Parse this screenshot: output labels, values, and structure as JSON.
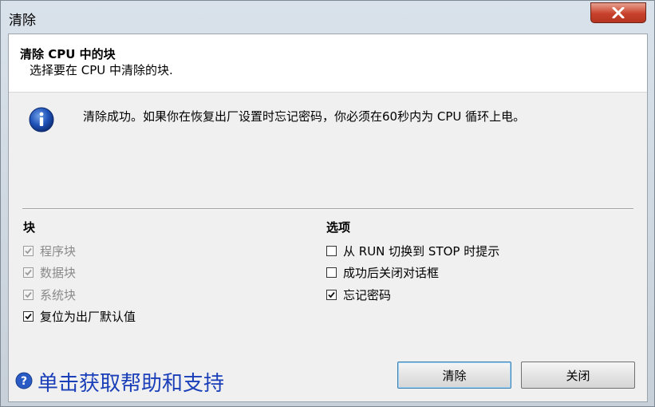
{
  "window": {
    "title": "清除"
  },
  "header": {
    "title": "清除 CPU 中的块",
    "subtitle": "选择要在 CPU 中清除的块."
  },
  "message": {
    "text": "清除成功。如果你在恢复出厂设置时忘记密码，你必须在60秒内为 CPU 循环上电。"
  },
  "blocks": {
    "title": "块",
    "items": [
      {
        "label": "程序块",
        "checked": true,
        "disabled": true
      },
      {
        "label": "数据块",
        "checked": true,
        "disabled": true
      },
      {
        "label": "系统块",
        "checked": true,
        "disabled": true
      },
      {
        "label": "复位为出厂默认值",
        "checked": true,
        "disabled": false
      }
    ]
  },
  "options": {
    "title": "选项",
    "items": [
      {
        "label": "从 RUN 切换到 STOP 时提示",
        "checked": false,
        "disabled": false
      },
      {
        "label": "成功后关闭对话框",
        "checked": false,
        "disabled": false
      },
      {
        "label": "忘记密码",
        "checked": true,
        "disabled": false
      }
    ]
  },
  "help": {
    "label": "单击获取帮助和支持"
  },
  "buttons": {
    "clear": "清除",
    "close": "关闭"
  },
  "colors": {
    "accent": "#1a3fb8",
    "close_button": "#c8412b"
  }
}
